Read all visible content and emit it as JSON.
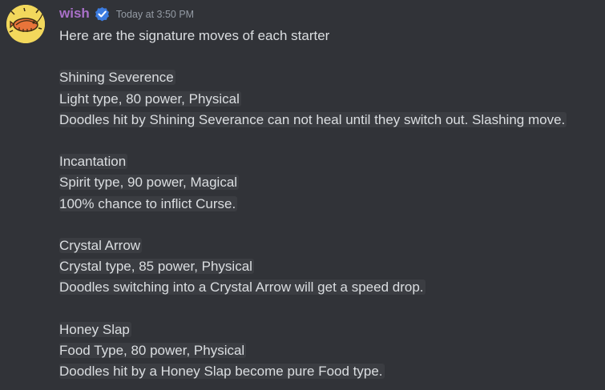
{
  "author": {
    "username": "wish",
    "timestamp": "Today at 3:50 PM",
    "verified_icon": "check-badge-icon",
    "avatar_icon": "shrimp-avatar-icon",
    "username_color": "#a970c8"
  },
  "message": {
    "intro": "Here are the signature moves of each starter",
    "moves": [
      {
        "name": "Shining Severence",
        "stats": "Light type, 80 power, Physical",
        "effect": "Doodles hit by Shining Severance can not heal until they switch out. Slashing move."
      },
      {
        "name": "Incantation",
        "stats": "Spirit type, 90 power, Magical",
        "effect": "100% chance to inflict Curse."
      },
      {
        "name": "Crystal Arrow",
        "stats": "Crystal type, 85 power, Physical",
        "effect": "Doodles switching into a Crystal Arrow will get a speed drop."
      },
      {
        "name": "Honey Slap",
        "stats": "Food Type, 80 power, Physical",
        "effect": "Doodles hit by a Honey Slap become pure Food type."
      }
    ]
  }
}
